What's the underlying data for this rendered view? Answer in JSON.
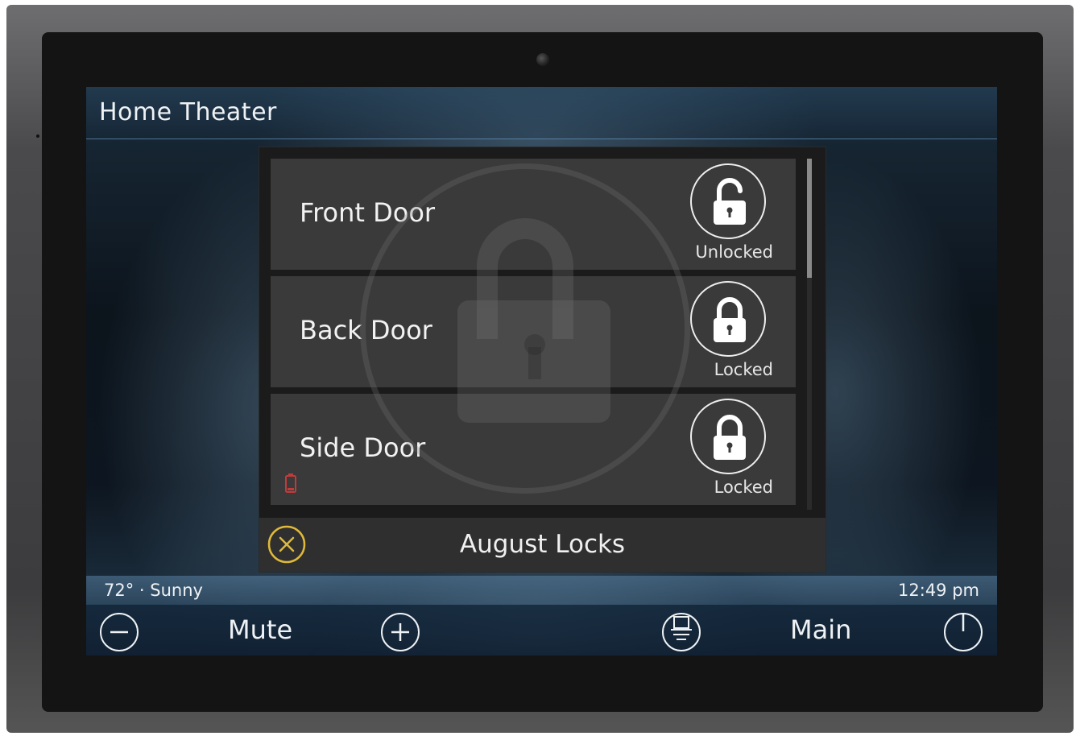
{
  "header": {
    "title": "Home Theater"
  },
  "modal": {
    "title": "August Locks",
    "locks": [
      {
        "name": "Front Door",
        "state": "Unlocked",
        "icon": "lock-open-icon"
      },
      {
        "name": "Back Door",
        "state": "Locked",
        "icon": "lock-closed-icon"
      },
      {
        "name": "Side Door",
        "state": "Locked",
        "icon": "lock-closed-icon",
        "low_battery": true
      }
    ],
    "close_icon": "close-icon",
    "accent_color": "#e0b93a"
  },
  "status": {
    "weather": "72° · Sunny",
    "time": "12:49 pm"
  },
  "controls": {
    "volume_down_icon": "minus-circle-icon",
    "mute_label": "Mute",
    "volume_up_icon": "plus-circle-icon",
    "source_icon": "source-icon",
    "main_label": "Main",
    "power_icon": "power-icon"
  },
  "colors": {
    "battery_warning": "#c23b3b"
  }
}
